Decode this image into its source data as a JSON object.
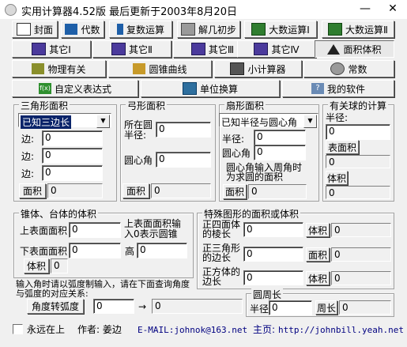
{
  "window": {
    "title": "实用计算器4.52版   最后更新于2003年8月20日",
    "minimize": "—",
    "close": "✕"
  },
  "toolbar_row1": [
    "封面",
    "代数",
    "复数运算",
    "解几初步",
    "大数运算Ⅰ",
    "大数运算Ⅱ"
  ],
  "toolbar_row2": [
    "其它Ⅰ",
    "其它Ⅱ",
    "其它Ⅲ",
    "其它Ⅳ",
    "面积体积"
  ],
  "toolbar_row3": [
    "物理有关",
    "圆锥曲线",
    "小计算器",
    "常数"
  ],
  "toolbar_row4": [
    "自定义表达式",
    "单位换算",
    "我的软件"
  ],
  "triangle": {
    "title": "三角形面积",
    "select": "已知三边长",
    "labels": [
      "边:",
      "边:",
      "边:"
    ],
    "values": [
      "0",
      "0",
      "0"
    ],
    "button": "面积",
    "result": "0"
  },
  "bow": {
    "title": "弓形面积",
    "radius_label": "所在圆半径:",
    "radius_value": "0",
    "angle_label": "圆心角",
    "angle_value": "0",
    "button": "面积",
    "result": "0"
  },
  "sector": {
    "title": "扇形面积",
    "select": "已知半径与圆心角",
    "labels": [
      "半径:",
      "圆心角"
    ],
    "values": [
      "0",
      "0"
    ],
    "note": "圆心角输入周角时为求圆的面积",
    "button": "面积",
    "result": "0"
  },
  "sphere": {
    "title": "有关球的计算",
    "radius_label": "半径:",
    "radius_value": "0",
    "area_button": "表面积",
    "area_result": "0",
    "volume_button": "体积",
    "volume_result": "0"
  },
  "frustum": {
    "title": "锥体、台体的体积",
    "upper_label": "上表面面积",
    "upper_value": "0",
    "hint": "上表面面积输入0表示圆锥",
    "lower_label": "下表面面积",
    "lower_value": "0",
    "height_label": "高",
    "height_value": "0",
    "button": "体积",
    "result": "0"
  },
  "special": {
    "title": "特殊图形的面积或体积",
    "rows": [
      {
        "label": "正四面体的棱长",
        "value": "0",
        "button": "体积",
        "result": "0"
      },
      {
        "label": "正三角形的边长",
        "value": "0",
        "button": "面积",
        "result": "0"
      },
      {
        "label": "正方体的边长",
        "value": "0",
        "button": "体积",
        "result": "0"
      }
    ]
  },
  "angle": {
    "note": "输入角时请以弧度制输入，请在下面查询角度与弧度的对应关系:",
    "button": "角度转弧度",
    "input": "0",
    "arrow": "→",
    "result": "0"
  },
  "circumference": {
    "title": "圆周长",
    "radius_label": "半径",
    "radius_value": "0",
    "button": "周长",
    "result": "0"
  },
  "footer": {
    "checkbox_label": "永远在上",
    "author": "作者: 姜边",
    "email": "E-MAIL:johnok@163.net",
    "homepage_label": "主页:",
    "homepage_url": "http://johnbill.yeah.net"
  }
}
